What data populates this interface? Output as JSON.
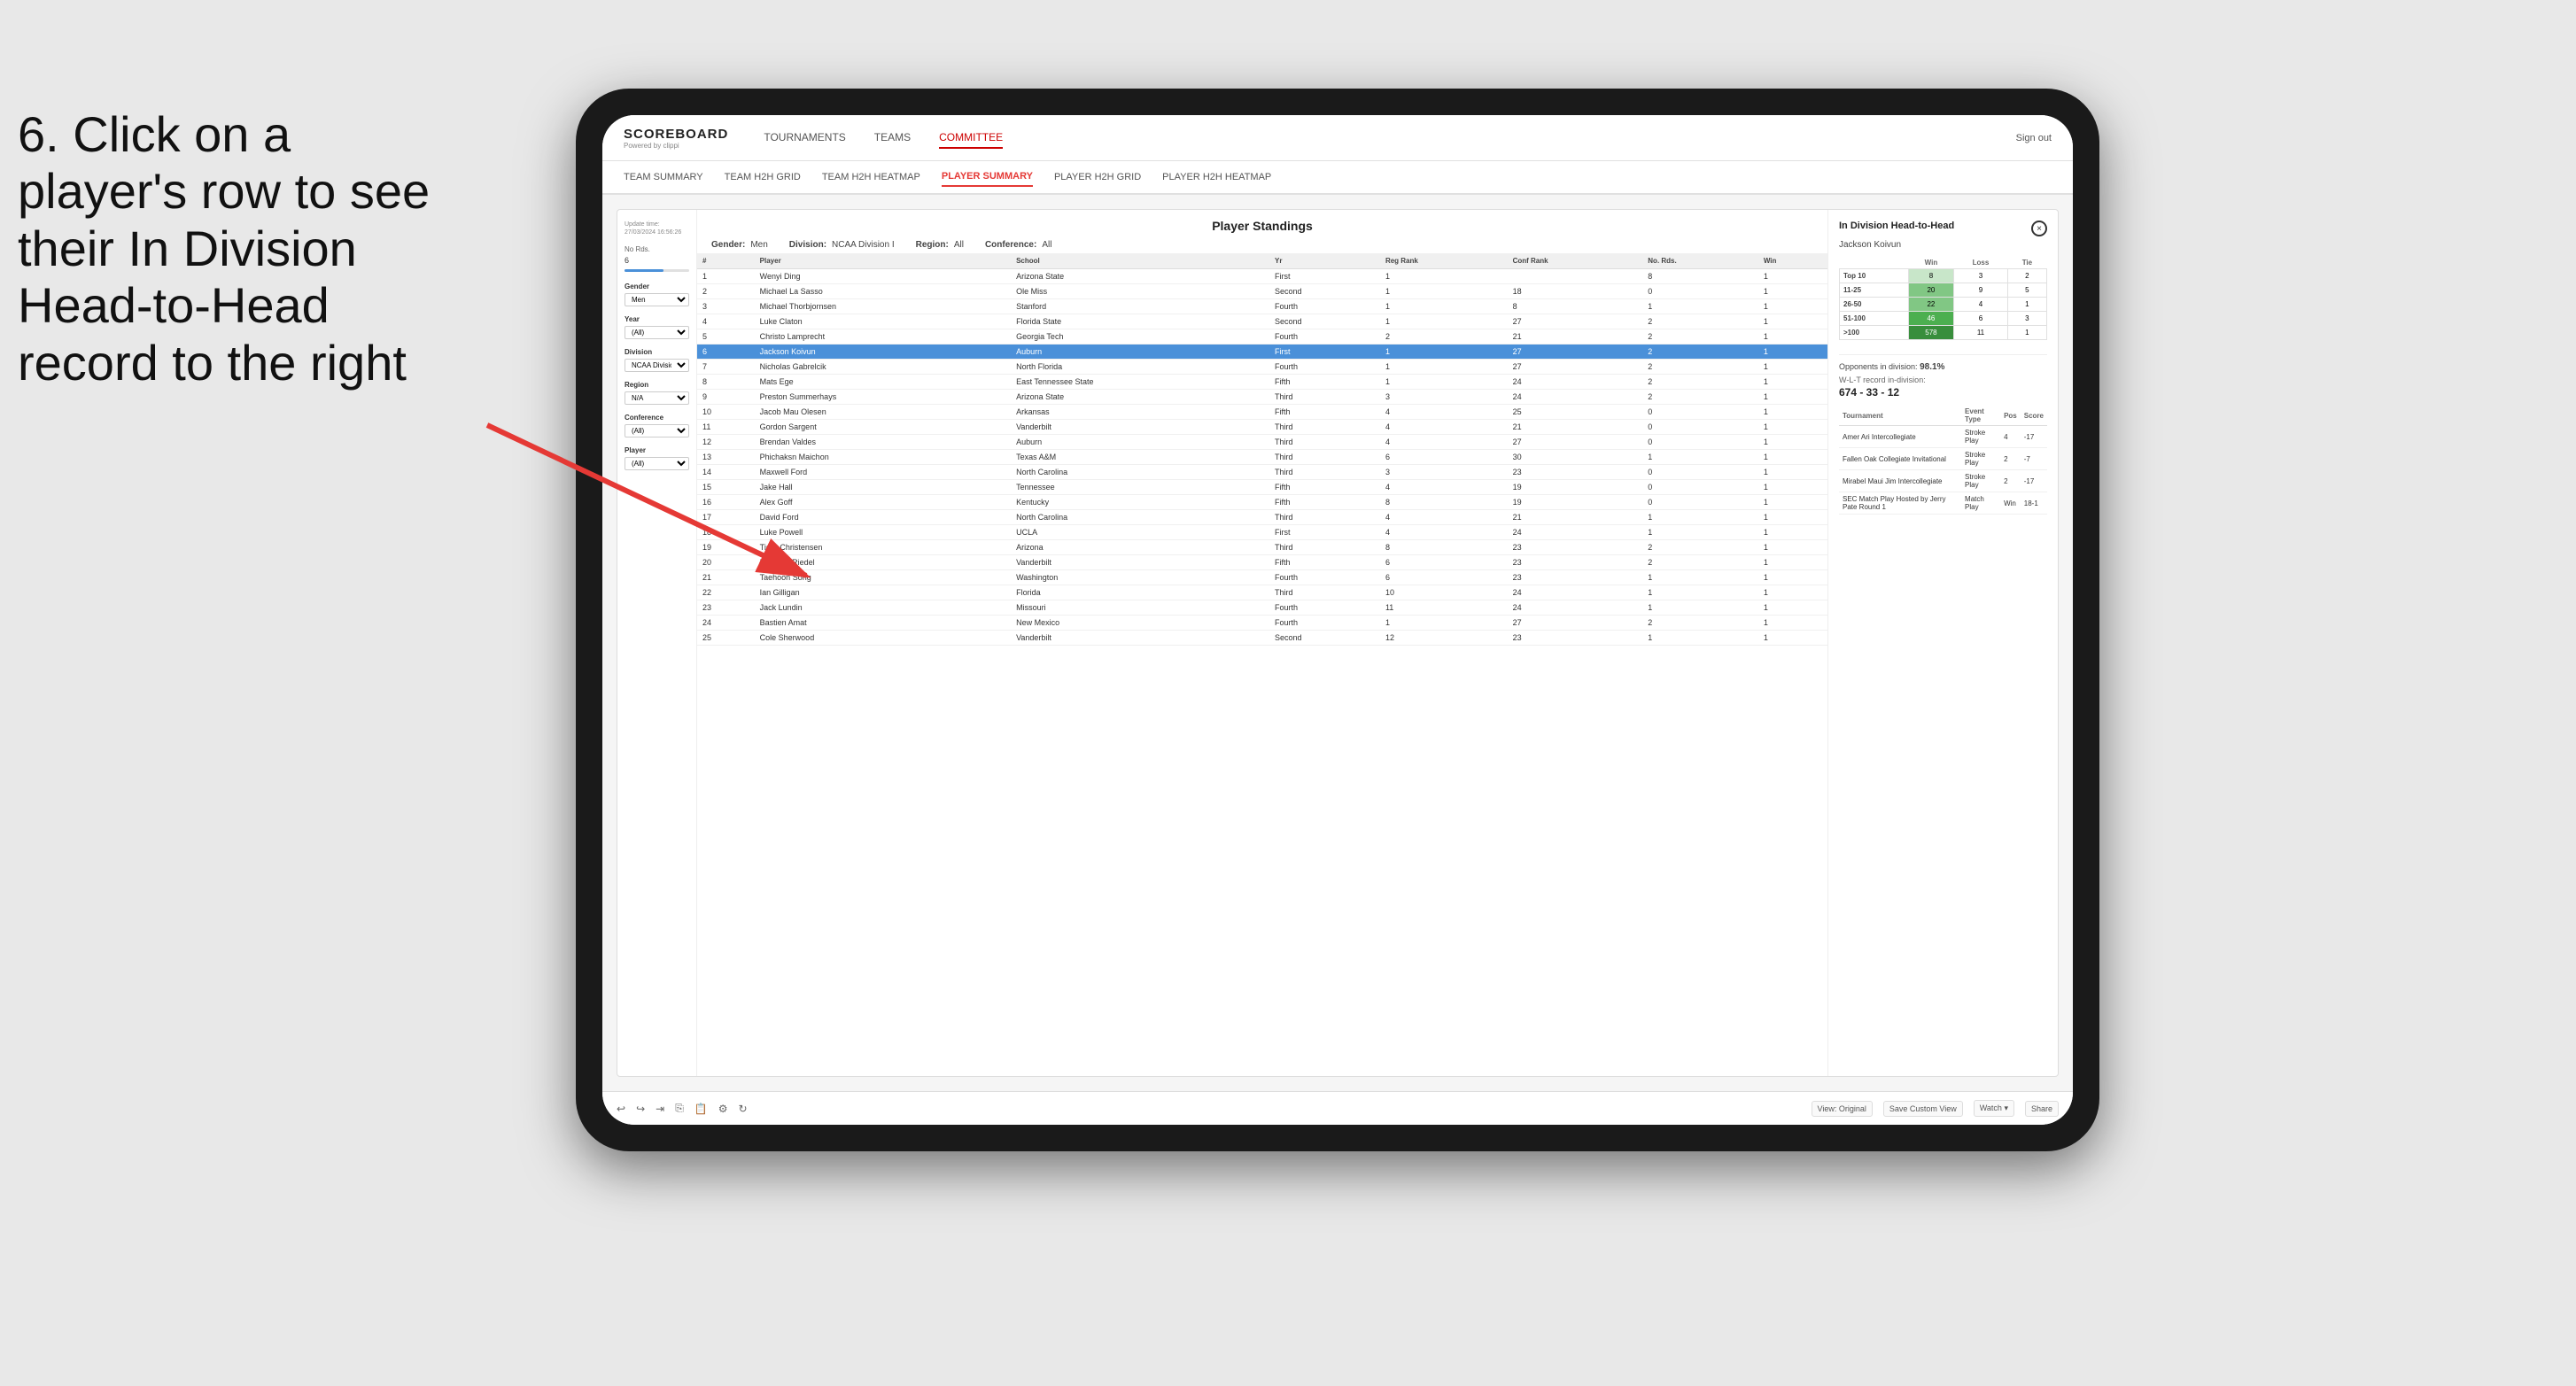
{
  "instruction": {
    "line1": "6. Click on a",
    "line2": "player's row to see",
    "line3": "their In Division",
    "line4": "Head-to-Head",
    "line5": "record to the right"
  },
  "app": {
    "logo_title": "SCOREBOARD",
    "logo_sub": "Powered by clippi",
    "nav": [
      "TOURNAMENTS",
      "TEAMS",
      "COMMITTEE"
    ],
    "sign_out": "Sign out",
    "sub_nav": [
      "TEAM SUMMARY",
      "TEAM H2H GRID",
      "TEAM H2H HEATMAP",
      "PLAYER SUMMARY",
      "PLAYER H2H GRID",
      "PLAYER H2H HEATMAP"
    ]
  },
  "panel": {
    "title": "Player Standings",
    "update_time": "Update time:",
    "update_date": "27/03/2024 16:56:26",
    "filters": {
      "gender": {
        "label": "Gender",
        "value": "Men"
      },
      "division": {
        "label": "Division",
        "value": "NCAA Division I"
      },
      "region": {
        "label": "Region",
        "value": "All"
      },
      "conference": {
        "label": "Conference",
        "value": "All"
      }
    },
    "sidebar_filters": {
      "no_rds_label": "No Rds.",
      "no_rds_range": "6",
      "gender_label": "Gender",
      "gender_value": "Men",
      "year_label": "Year",
      "year_value": "(All)",
      "division_label": "Division",
      "division_value": "NCAA Division I",
      "region_label": "Region",
      "region_value": "N/A",
      "conference_label": "Conference",
      "conference_value": "(All)",
      "player_label": "Player",
      "player_value": "(All)"
    }
  },
  "table": {
    "headers": [
      "#",
      "Player",
      "School",
      "Yr",
      "Reg Rank",
      "Conf Rank",
      "No. Rds.",
      "Win"
    ],
    "rows": [
      {
        "num": 1,
        "player": "Wenyi Ding",
        "school": "Arizona State",
        "yr": "First",
        "reg": 1,
        "conf": "",
        "rds": 8,
        "win": 1,
        "selected": false
      },
      {
        "num": 2,
        "player": "Michael La Sasso",
        "school": "Ole Miss",
        "yr": "Second",
        "reg": 1,
        "conf": 18,
        "rds": 0,
        "win": 1,
        "selected": false
      },
      {
        "num": 3,
        "player": "Michael Thorbjornsen",
        "school": "Stanford",
        "yr": "Fourth",
        "reg": 1,
        "conf": 8,
        "rds": 1,
        "win": 1,
        "selected": false
      },
      {
        "num": 4,
        "player": "Luke Claton",
        "school": "Florida State",
        "yr": "Second",
        "reg": 1,
        "conf": 27,
        "rds": 2,
        "win": 1,
        "selected": false
      },
      {
        "num": 5,
        "player": "Christo Lamprecht",
        "school": "Georgia Tech",
        "yr": "Fourth",
        "reg": 2,
        "conf": 21,
        "rds": 2,
        "win": 1,
        "selected": false
      },
      {
        "num": 6,
        "player": "Jackson Koivun",
        "school": "Auburn",
        "yr": "First",
        "reg": 1,
        "conf": 27,
        "rds": 2,
        "win": 1,
        "selected": true
      },
      {
        "num": 7,
        "player": "Nicholas Gabrelcik",
        "school": "North Florida",
        "yr": "Fourth",
        "reg": 1,
        "conf": 27,
        "rds": 2,
        "win": 1,
        "selected": false
      },
      {
        "num": 8,
        "player": "Mats Ege",
        "school": "East Tennessee State",
        "yr": "Fifth",
        "reg": 1,
        "conf": 24,
        "rds": 2,
        "win": 1,
        "selected": false
      },
      {
        "num": 9,
        "player": "Preston Summerhays",
        "school": "Arizona State",
        "yr": "Third",
        "reg": 3,
        "conf": 24,
        "rds": 2,
        "win": 1,
        "selected": false
      },
      {
        "num": 10,
        "player": "Jacob Mau Olesen",
        "school": "Arkansas",
        "yr": "Fifth",
        "reg": 4,
        "conf": 25,
        "rds": 0,
        "win": 1,
        "selected": false
      },
      {
        "num": 11,
        "player": "Gordon Sargent",
        "school": "Vanderbilt",
        "yr": "Third",
        "reg": 4,
        "conf": 21,
        "rds": 0,
        "win": 1,
        "selected": false
      },
      {
        "num": 12,
        "player": "Brendan Valdes",
        "school": "Auburn",
        "yr": "Third",
        "reg": 4,
        "conf": 27,
        "rds": 0,
        "win": 1,
        "selected": false
      },
      {
        "num": 13,
        "player": "Phichaksn Maichon",
        "school": "Texas A&M",
        "yr": "Third",
        "reg": 6,
        "conf": 30,
        "rds": 1,
        "win": 1,
        "selected": false
      },
      {
        "num": 14,
        "player": "Maxwell Ford",
        "school": "North Carolina",
        "yr": "Third",
        "reg": 3,
        "conf": 23,
        "rds": 0,
        "win": 1,
        "selected": false
      },
      {
        "num": 15,
        "player": "Jake Hall",
        "school": "Tennessee",
        "yr": "Fifth",
        "reg": 4,
        "conf": 19,
        "rds": 0,
        "win": 1,
        "selected": false
      },
      {
        "num": 16,
        "player": "Alex Goff",
        "school": "Kentucky",
        "yr": "Fifth",
        "reg": 8,
        "conf": 19,
        "rds": 0,
        "win": 1,
        "selected": false
      },
      {
        "num": 17,
        "player": "David Ford",
        "school": "North Carolina",
        "yr": "Third",
        "reg": 4,
        "conf": 21,
        "rds": 1,
        "win": 1,
        "selected": false
      },
      {
        "num": 18,
        "player": "Luke Powell",
        "school": "UCLA",
        "yr": "First",
        "reg": 4,
        "conf": 24,
        "rds": 1,
        "win": 1,
        "selected": false
      },
      {
        "num": 19,
        "player": "Tiger Christensen",
        "school": "Arizona",
        "yr": "Third",
        "reg": 8,
        "conf": 23,
        "rds": 2,
        "win": 1,
        "selected": false
      },
      {
        "num": 20,
        "player": "Matthew Riedel",
        "school": "Vanderbilt",
        "yr": "Fifth",
        "reg": 6,
        "conf": 23,
        "rds": 2,
        "win": 1,
        "selected": false
      },
      {
        "num": 21,
        "player": "Taehoon Song",
        "school": "Washington",
        "yr": "Fourth",
        "reg": 6,
        "conf": 23,
        "rds": 1,
        "win": 1,
        "selected": false
      },
      {
        "num": 22,
        "player": "Ian Gilligan",
        "school": "Florida",
        "yr": "Third",
        "reg": 10,
        "conf": 24,
        "rds": 1,
        "win": 1,
        "selected": false
      },
      {
        "num": 23,
        "player": "Jack Lundin",
        "school": "Missouri",
        "yr": "Fourth",
        "reg": 11,
        "conf": 24,
        "rds": 1,
        "win": 1,
        "selected": false
      },
      {
        "num": 24,
        "player": "Bastien Amat",
        "school": "New Mexico",
        "yr": "Fourth",
        "reg": 1,
        "conf": 27,
        "rds": 2,
        "win": 1,
        "selected": false
      },
      {
        "num": 25,
        "player": "Cole Sherwood",
        "school": "Vanderbilt",
        "yr": "Second",
        "reg": 12,
        "conf": 23,
        "rds": 1,
        "win": 1,
        "selected": false
      }
    ]
  },
  "h2h": {
    "title": "In Division Head-to-Head",
    "player": "Jackson Koivun",
    "close_label": "×",
    "stats_headers": [
      "Win",
      "Loss",
      "Tie"
    ],
    "stats_rows": [
      {
        "range": "Top 10",
        "win": 8,
        "loss": 3,
        "tie": 2
      },
      {
        "range": "11-25",
        "win": 20,
        "loss": 9,
        "tie": 5
      },
      {
        "range": "26-50",
        "win": 22,
        "loss": 4,
        "tie": 1
      },
      {
        "range": "51-100",
        "win": 46,
        "loss": 6,
        "tie": 3
      },
      {
        "range": ">100",
        "win": 578,
        "loss": 11,
        "tie": 1
      }
    ],
    "opponents_label": "Opponents in division:",
    "record_label": "W-L-T record in-division:",
    "opponents_pct": "98.1%",
    "record": "674 - 33 - 12",
    "tournament_headers": [
      "Tournament",
      "Event Type",
      "Pos",
      "Score"
    ],
    "tournaments": [
      {
        "name": "Amer Ari Intercollegiate",
        "type": "Stroke Play",
        "pos": 4,
        "score": "-17"
      },
      {
        "name": "Fallen Oak Collegiate Invitational",
        "type": "Stroke Play",
        "pos": 2,
        "score": "-7"
      },
      {
        "name": "Mirabel Maui Jim Intercollegiate",
        "type": "Stroke Play",
        "pos": 2,
        "score": "-17"
      },
      {
        "name": "SEC Match Play Hosted by Jerry Pate Round 1",
        "type": "Match Play",
        "pos": "Win",
        "score": "18-1"
      }
    ]
  },
  "toolbar": {
    "view_original": "View: Original",
    "save_custom": "Save Custom View",
    "watch": "Watch ▾",
    "share": "Share"
  }
}
